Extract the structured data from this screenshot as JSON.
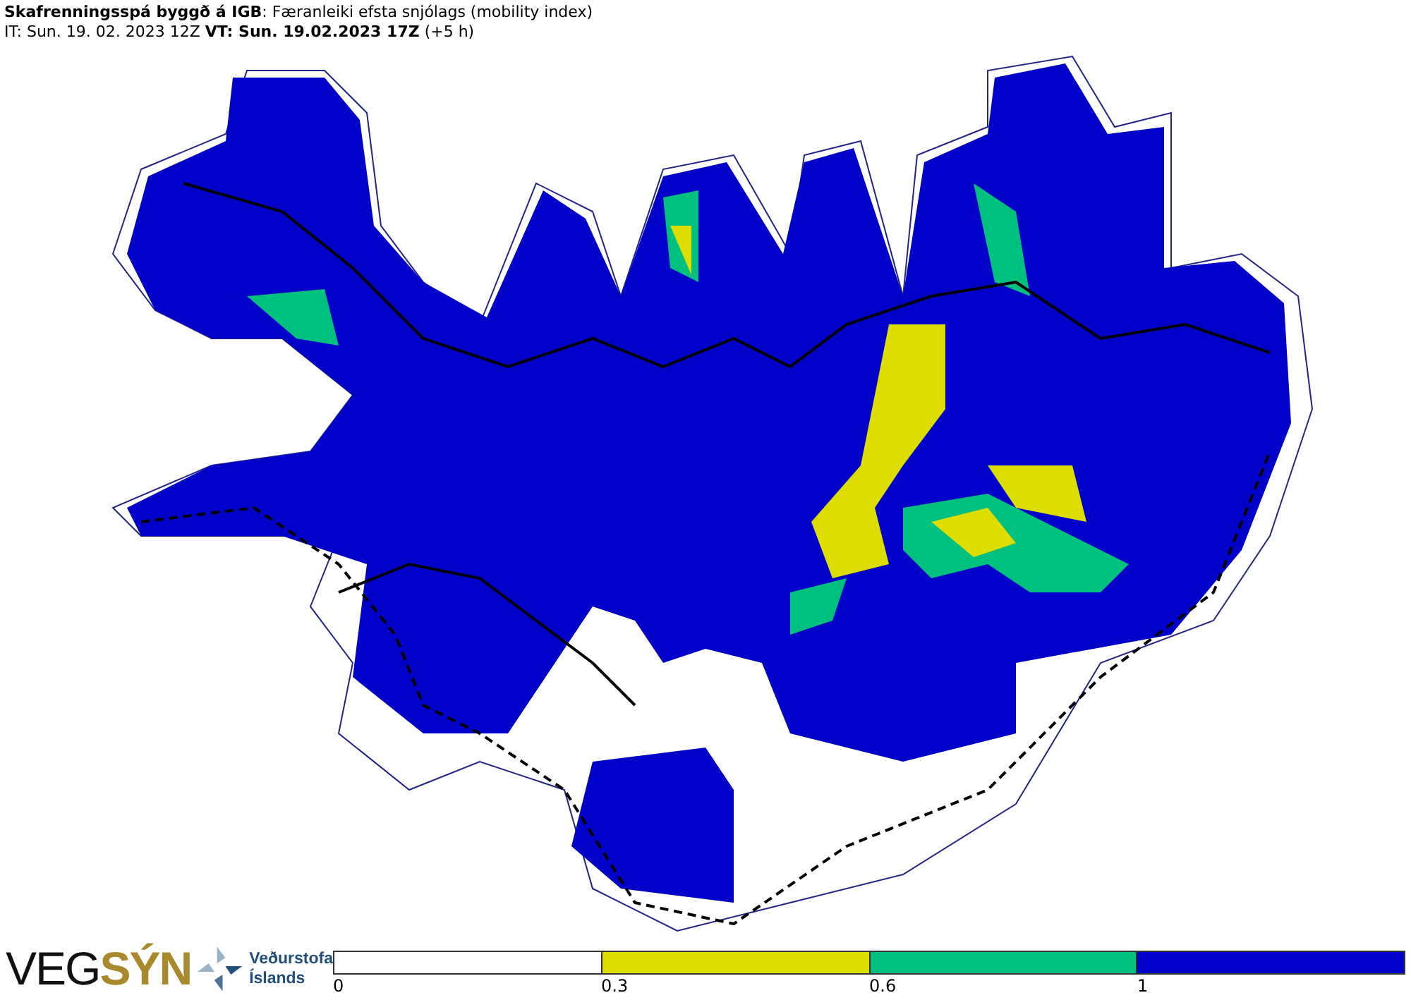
{
  "header": {
    "title": "**Skafrenningsspá byggð á IGB**: Færanleiki efsta snjólags (mobility index)",
    "times": "IT: Sun. 19. 02. 2023 12Z **VT: Sun. 19.02.2023 17Z** (+5 h)"
  },
  "logos": {
    "vegsyn": {
      "part1": "VEG",
      "part2": "SÝN"
    },
    "vedurstofa": [
      "Veðurstofa",
      "Íslands"
    ]
  },
  "legend": {
    "segments": [
      {
        "color": "#ffffff"
      },
      {
        "color": "#dddd00"
      },
      {
        "color": "#00c080"
      },
      {
        "color": "#0000c8"
      }
    ],
    "ticks": [
      "0",
      "0.3",
      "0.6",
      "1"
    ]
  }
}
